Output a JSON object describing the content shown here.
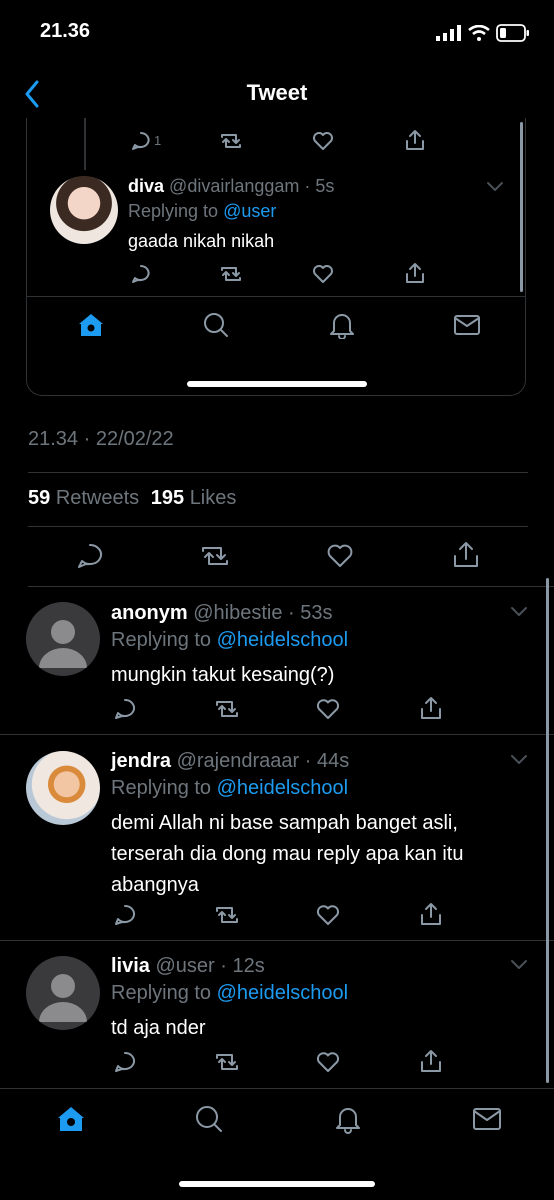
{
  "status_bar": {
    "time": "21.36"
  },
  "header": {
    "title": "Tweet"
  },
  "embedded": {
    "top_reply_count": "1",
    "tweet": {
      "name": "diva",
      "handle": "@divairlanggam · 5s",
      "replying_label": "Replying to",
      "replying_to": "@user",
      "text": "gaada nikah nikah"
    }
  },
  "tweet_meta": {
    "timestamp": "21.34 · 22/02/22",
    "retweets_count": "59",
    "retweets_label": "Retweets",
    "likes_count": "195",
    "likes_label": "Likes"
  },
  "replies": [
    {
      "name": "anonym",
      "handle": "@hibestie · 53s",
      "replying_label": "Replying to",
      "replying_to": "@heidelschool",
      "text_lines": [
        "mungkin takut kesaing(?)"
      ]
    },
    {
      "name": "jendra",
      "handle": "@rajendraaar · 44s",
      "replying_label": "Replying to",
      "replying_to": "@heidelschool",
      "text_lines": [
        "demi Allah ni base sampah banget asli,",
        "terserah dia dong mau reply apa kan itu",
        "abangnya"
      ]
    },
    {
      "name": "livia",
      "handle": "@user · 12s",
      "replying_label": "Replying to",
      "replying_to": "@heidelschool",
      "text_lines": [
        "td aja nder"
      ]
    }
  ],
  "colors": {
    "accent": "#1d9bf0",
    "background": "#000000",
    "muted": "#6e767d",
    "border": "#2f3336"
  },
  "icons": [
    "back-chevron-icon",
    "reply-icon",
    "retweet-icon",
    "like-icon",
    "share-icon",
    "home-icon",
    "search-icon",
    "notifications-icon",
    "messages-icon"
  ]
}
